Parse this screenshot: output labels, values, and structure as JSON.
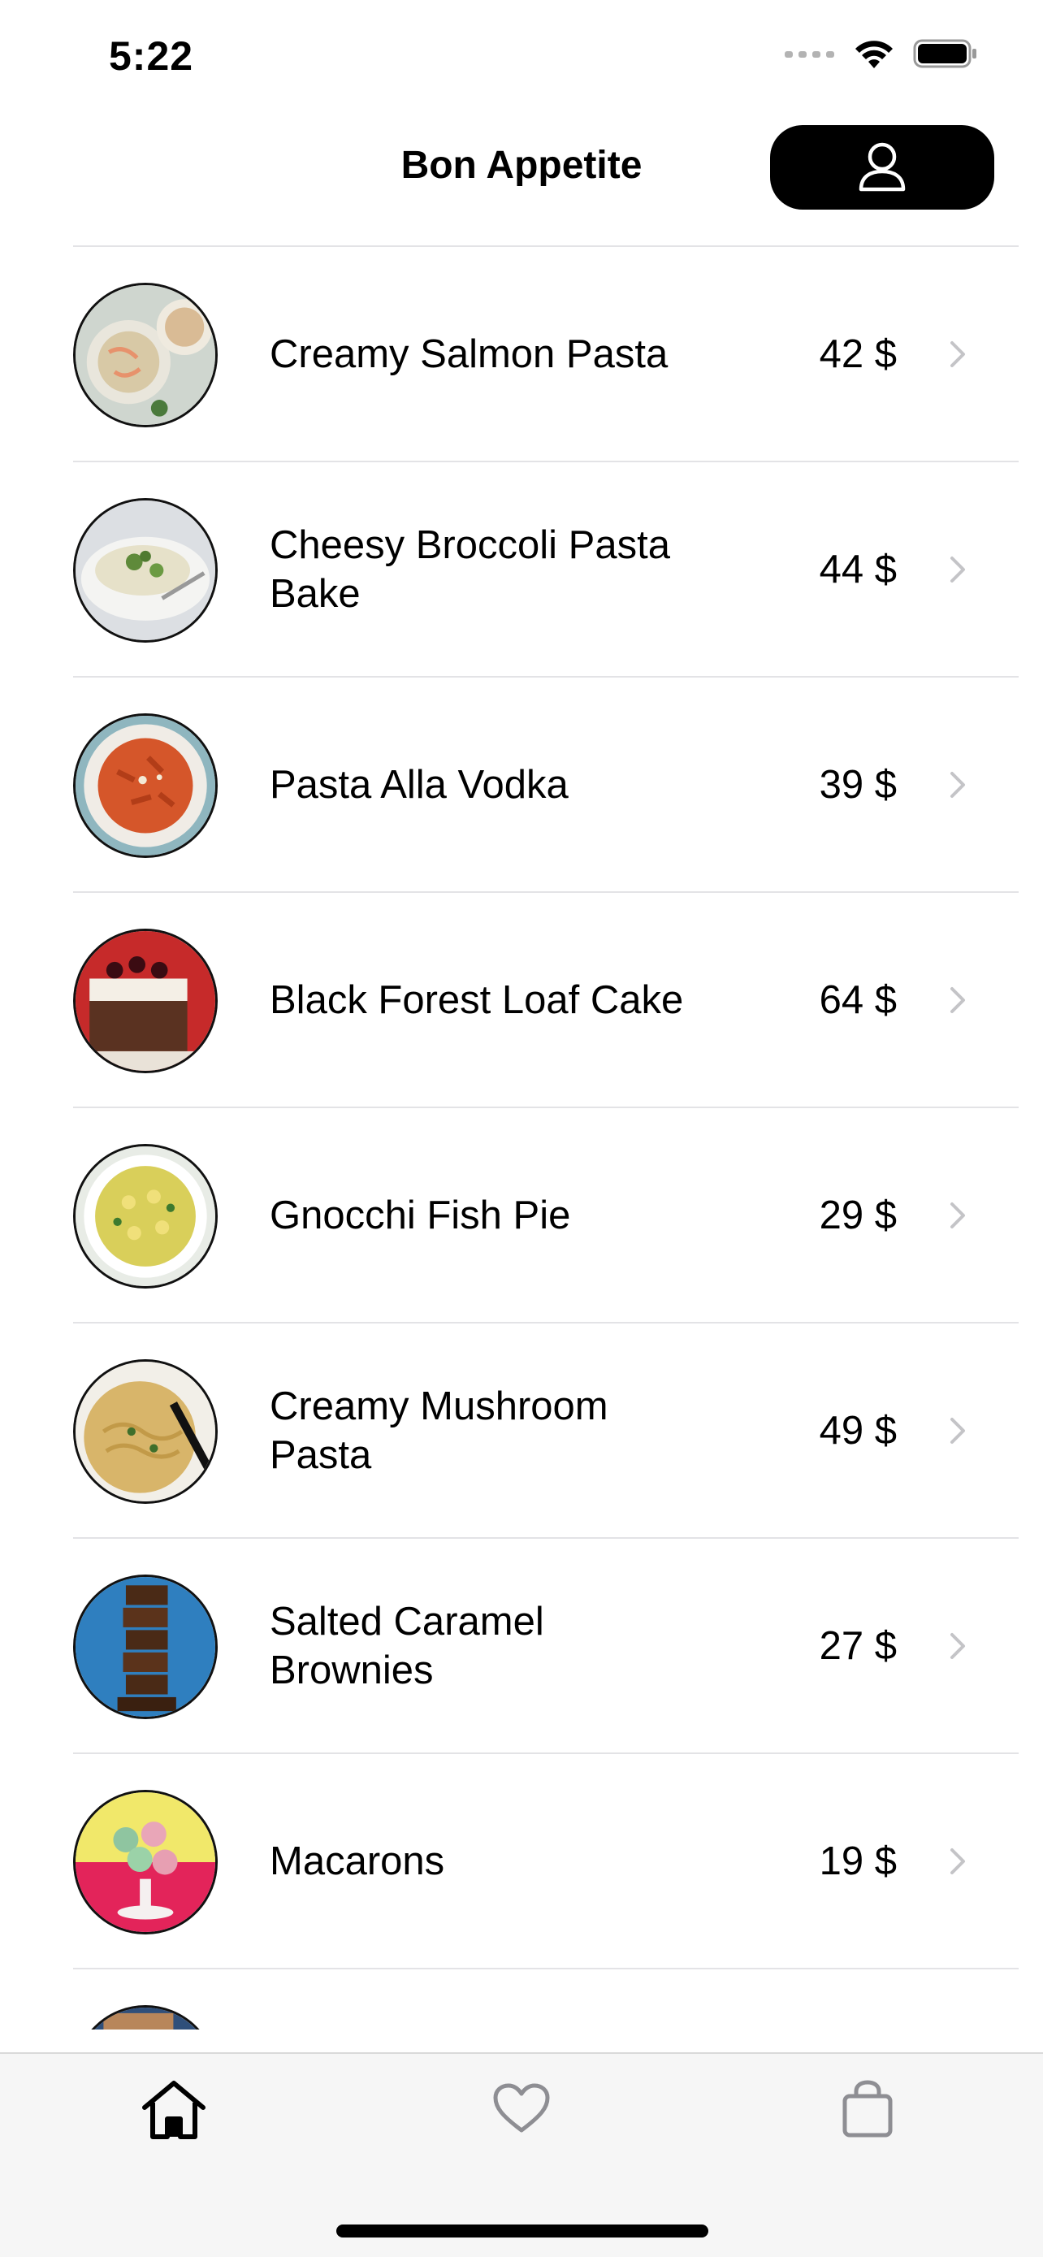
{
  "status_bar": {
    "time": "5:22",
    "icons": [
      "signal-icon",
      "wifi-icon",
      "battery-icon"
    ]
  },
  "nav": {
    "title": "Bon Appetite",
    "profile_icon": "person-icon"
  },
  "menu": {
    "items": [
      {
        "name": "Creamy Salmon Pasta",
        "price": "42 $"
      },
      {
        "name": "Cheesy Broccoli Pasta Bake",
        "price": "44 $"
      },
      {
        "name": "Pasta Alla Vodka",
        "price": "39 $"
      },
      {
        "name": "Black Forest Loaf Cake",
        "price": "64 $"
      },
      {
        "name": "Gnocchi Fish Pie",
        "price": "29 $"
      },
      {
        "name": "Creamy Mushroom Pasta",
        "price": "49 $"
      },
      {
        "name": "Salted Caramel Brownies",
        "price": "27 $"
      },
      {
        "name": "Macarons",
        "price": "19 $"
      }
    ]
  },
  "tab_bar": {
    "tabs": [
      {
        "icon": "home-icon",
        "active": true
      },
      {
        "icon": "heart-icon",
        "active": false
      },
      {
        "icon": "bag-icon",
        "active": false
      }
    ]
  },
  "colors": {
    "accent": "#000000",
    "separator": "#e3e3e6",
    "tab_bar_bg": "#f6f6f6",
    "inactive_icon": "#8e8e93"
  }
}
